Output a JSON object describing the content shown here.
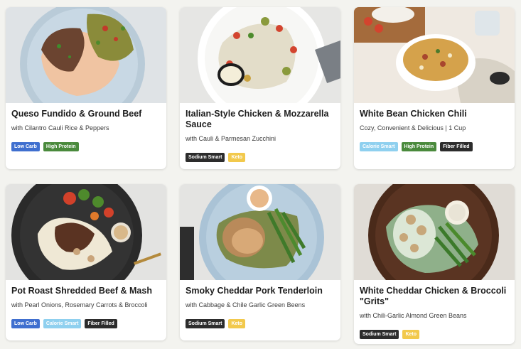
{
  "tag_styles": {
    "Low Carb": {
      "bg": "#3f6fcf",
      "fg": "#ffffff"
    },
    "High Protein": {
      "bg": "#4a8a3c",
      "fg": "#ffffff"
    },
    "Sodium Smart": {
      "bg": "#2c2c2c",
      "fg": "#ffffff"
    },
    "Keto": {
      "bg": "#f2c94c",
      "fg": "#ffffff"
    },
    "Calorie Smart": {
      "bg": "#8fd0ef",
      "fg": "#ffffff"
    },
    "Fiber Filled": {
      "bg": "#2c2c2c",
      "fg": "#ffffff"
    }
  },
  "meals": [
    {
      "title": "Queso Fundido & Ground Beef",
      "subtitle": "with Cilantro Cauli Rice & Peppers",
      "tags": [
        "Low Carb",
        "High Protein"
      ],
      "photo": "beef-queso-plate"
    },
    {
      "title": "Italian-Style Chicken & Mozzarella Sauce",
      "subtitle": "with Cauli & Parmesan Zucchini",
      "tags": [
        "Sodium Smart",
        "Keto"
      ],
      "photo": "chicken-veg-plate"
    },
    {
      "title": "White Bean Chicken Chili",
      "subtitle": "Cozy, Convenient & Delicious | 1 Cup",
      "tags": [
        "Calorie Smart",
        "High Protein",
        "Fiber Filled"
      ],
      "photo": "chili-bowl"
    },
    {
      "title": "Pot Roast Shredded Beef & Mash",
      "subtitle": "with Pearl Onions, Rosemary Carrots & Broccoli",
      "tags": [
        "Low Carb",
        "Calorie Smart",
        "Fiber Filled"
      ],
      "photo": "pot-roast-plate"
    },
    {
      "title": "Smoky Cheddar Pork Tenderloin",
      "subtitle": "with Cabbage & Chile Garlic Green Beens",
      "tags": [
        "Sodium Smart",
        "Keto"
      ],
      "photo": "pork-greenbean-plate"
    },
    {
      "title": "White Cheddar Chicken & Broccoli \"Grits\"",
      "subtitle": "with Chili-Garlic Almond Green Beans",
      "tags": [
        "Sodium Smart",
        "Keto"
      ],
      "photo": "chicken-grits-plate"
    }
  ]
}
